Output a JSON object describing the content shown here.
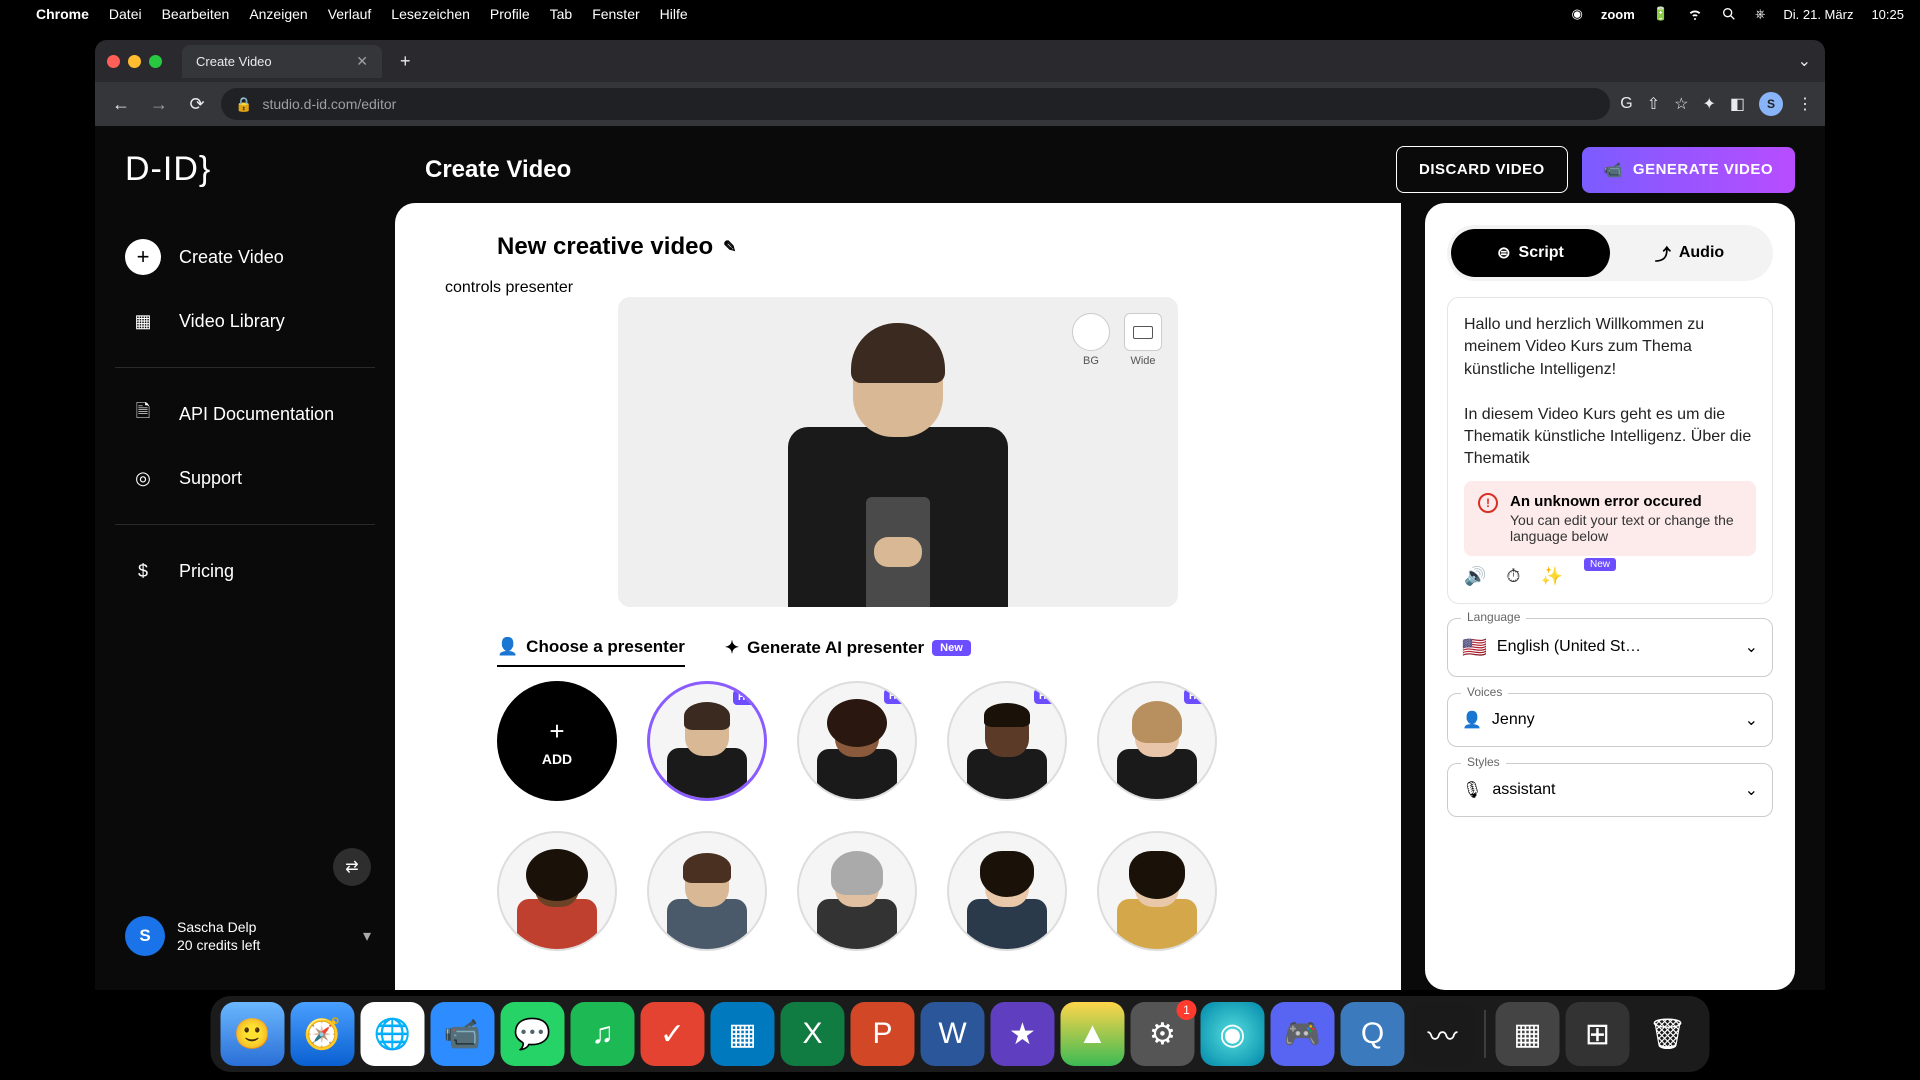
{
  "mac_menubar": {
    "app": "Chrome",
    "items": [
      "Datei",
      "Bearbeiten",
      "Anzeigen",
      "Verlauf",
      "Lesezeichen",
      "Profile",
      "Tab",
      "Fenster",
      "Hilfe"
    ],
    "status": {
      "zoom": "zoom",
      "date": "Di. 21. März",
      "time": "10:25"
    }
  },
  "browser": {
    "tab_title": "Create Video",
    "url": "studio.d-id.com/editor",
    "profile_initial": "S"
  },
  "sidebar": {
    "logo": "D-ID}",
    "create": "Create Video",
    "library": "Video Library",
    "api": "API Documentation",
    "support": "Support",
    "pricing": "Pricing",
    "user_name": "Sascha Delp",
    "user_credits": "20 credits left",
    "user_initial": "S"
  },
  "header": {
    "title": "Create Video",
    "discard": "DISCARD VIDEO",
    "generate": "GENERATE VIDEO"
  },
  "canvas": {
    "video_title": "New creative video",
    "bg_label": "BG",
    "wide_label": "Wide",
    "tab_choose": "Choose a presenter",
    "tab_generate": "Generate AI presenter",
    "new_badge": "New",
    "add_label": "ADD",
    "hq": "HQ"
  },
  "right": {
    "tab_script": "Script",
    "tab_audio": "Audio",
    "script_text": "Hallo und herzlich Willkommen zu meinem Video Kurs zum Thema künstliche Intelligenz!\n\nIn diesem Video Kurs geht es um die Thematik künstliche Intelligenz. Über die Thematik",
    "error_title": "An unknown error occured",
    "error_msg": "You can edit your text or change the language below",
    "tool_new": "New",
    "language_label": "Language",
    "language_value": "English (United St…",
    "voices_label": "Voices",
    "voices_value": "Jenny",
    "styles_label": "Styles",
    "styles_value": "assistant"
  },
  "dock": {
    "settings_badge": "1"
  }
}
